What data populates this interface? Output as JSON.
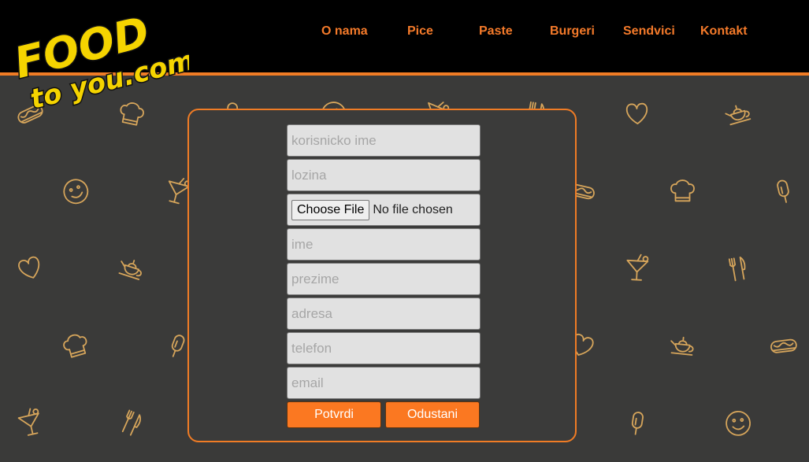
{
  "colors": {
    "accent": "#f07c25",
    "nav_text": "#f47a2a",
    "header_bg": "#000000",
    "pattern_icon": "#d6a55b",
    "logo_yellow": "#f5d400"
  },
  "logo": {
    "line1": "FOOD",
    "line2": "to you.com"
  },
  "nav": {
    "items": [
      {
        "label": "O nama"
      },
      {
        "label": "Pice"
      },
      {
        "label": "Paste"
      },
      {
        "label": "Burgeri"
      },
      {
        "label": "Sendvici"
      },
      {
        "label": "Kontakt"
      }
    ]
  },
  "form": {
    "username": {
      "placeholder": "korisnicko ime",
      "value": ""
    },
    "password": {
      "placeholder": "lozina",
      "value": ""
    },
    "file": {
      "button_label": "Choose File",
      "status": "No file chosen"
    },
    "first_name": {
      "placeholder": "ime",
      "value": ""
    },
    "last_name": {
      "placeholder": "prezime",
      "value": ""
    },
    "address": {
      "placeholder": "adresa",
      "value": ""
    },
    "phone": {
      "placeholder": "telefon",
      "value": ""
    },
    "email": {
      "placeholder": "email",
      "value": ""
    },
    "submit_label": "Potvrdi",
    "cancel_label": "Odustani"
  },
  "background_icons": [
    "hotdog-icon",
    "smiley-icon",
    "heart-icon",
    "chef-hat-icon",
    "cocktail-icon",
    "teapot-icon",
    "popsicle-icon",
    "fork-knife-icon"
  ]
}
